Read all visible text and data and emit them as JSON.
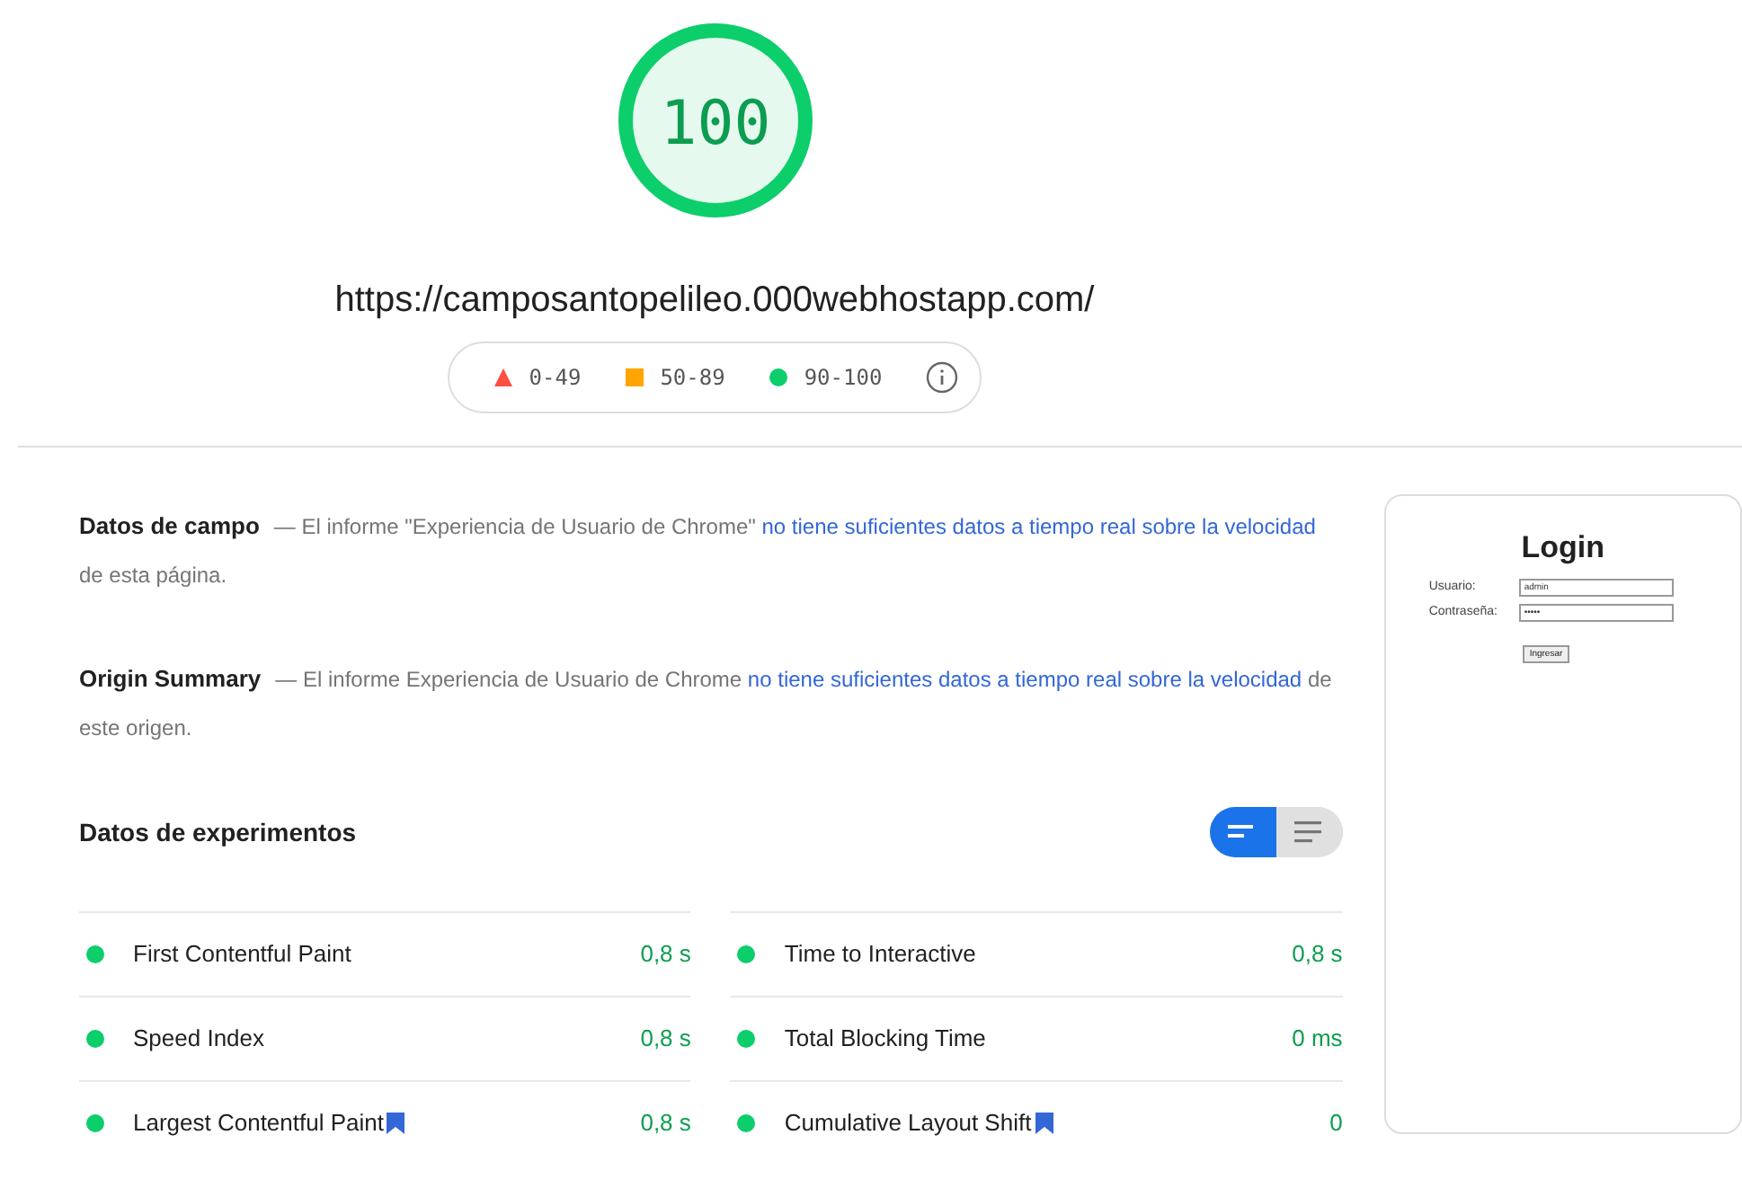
{
  "score": {
    "value": "100",
    "url": "https://camposantopelileo.000webhostapp.com/"
  },
  "legend": [
    {
      "kind": "triangle",
      "color": "#ff4e42",
      "label": "0-49"
    },
    {
      "kind": "square",
      "color": "#ffa400",
      "label": "50-89"
    },
    {
      "kind": "circle",
      "color": "#0cce6b",
      "label": "90-100"
    }
  ],
  "notes": [
    {
      "title": "Datos de campo",
      "text": "— El informe \"Experiencia de Usuario de Chrome\"",
      "link": "no tiene suficientes datos a tiempo real sobre la velocidad",
      "suffix": "de esta página."
    },
    {
      "title": "Origin Summary",
      "text": "— El informe Experiencia de Usuario de Chrome",
      "link": "no tiene suficientes datos a tiempo real sobre la velocidad",
      "suffix": "de este origen."
    }
  ],
  "lab": {
    "title": "Datos de experimentos",
    "toggle": [
      {
        "kind": "compact",
        "selected": true
      },
      {
        "kind": "list",
        "selected": false
      }
    ],
    "metrics": [
      {
        "name": "First Contentful Paint",
        "value": "0,8 s",
        "color": "#0cce6b",
        "flagged": false
      },
      {
        "name": "Time to Interactive",
        "value": "0,8 s",
        "color": "#0cce6b",
        "flagged": false
      },
      {
        "name": "Speed Index",
        "value": "0,8 s",
        "color": "#0cce6b",
        "flagged": false
      },
      {
        "name": "Total Blocking Time",
        "value": "0 ms",
        "color": "#0cce6b",
        "flagged": false
      },
      {
        "name": "Largest Contentful Paint",
        "value": "0,8 s",
        "color": "#0cce6b",
        "flagged": true
      },
      {
        "name": "Cumulative Layout Shift",
        "value": "0",
        "color": "#0cce6b",
        "flagged": true
      }
    ]
  },
  "screenshot": {
    "title": "Login",
    "fields": [
      {
        "label": "Usuario:",
        "value": "admin"
      },
      {
        "label": "Contraseña:",
        "value": "•••••"
      }
    ],
    "button": "Ingresar"
  }
}
